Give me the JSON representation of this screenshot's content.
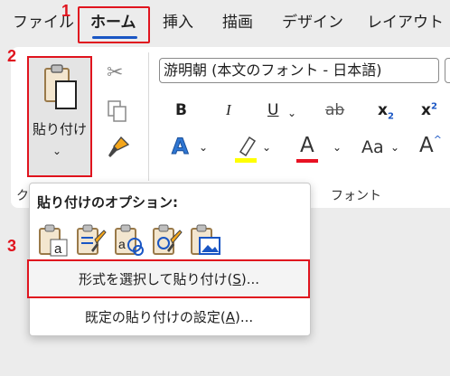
{
  "tabs": [
    {
      "label": "ファイル"
    },
    {
      "label": "ホーム"
    },
    {
      "label": "挿入"
    },
    {
      "label": "描画"
    },
    {
      "label": "デザイン"
    },
    {
      "label": "レイアウト"
    }
  ],
  "steps": [
    "1",
    "2",
    "3"
  ],
  "clipboard": {
    "paste_label": "貼り付け",
    "group_label_fragment": "ク"
  },
  "font": {
    "name": "游明朝 (本文のフォント - 日本語)",
    "group_label": "フォント"
  },
  "format_buttons": {
    "bold": "B",
    "italic": "I",
    "underline": "U",
    "strike": "ab",
    "subscript": "x",
    "superscript": "x"
  },
  "big_buttons": {
    "text_effect": "A",
    "font_color": "A",
    "change_case": "Aa"
  },
  "paste_options": {
    "title": "貼り付けのオプション:",
    "icons": [
      "keep-text-only-icon",
      "merge-formatting-icon",
      "keep-source-formatting-icon",
      "use-destination-styles-icon",
      "picture-icon"
    ]
  },
  "menu": {
    "paste_special_prefix": "形式を選択して貼り付け(",
    "paste_special_key": "S",
    "paste_special_suffix": ")...",
    "default_prefix": "既定の貼り付けの設定(",
    "default_key": "A",
    "default_suffix": ")..."
  },
  "colors": {
    "highlight_red": "#e0141e",
    "accent_blue": "#1a56c4",
    "font_color_bar": "#e81123",
    "highlight_yellow": "#ffff00"
  }
}
